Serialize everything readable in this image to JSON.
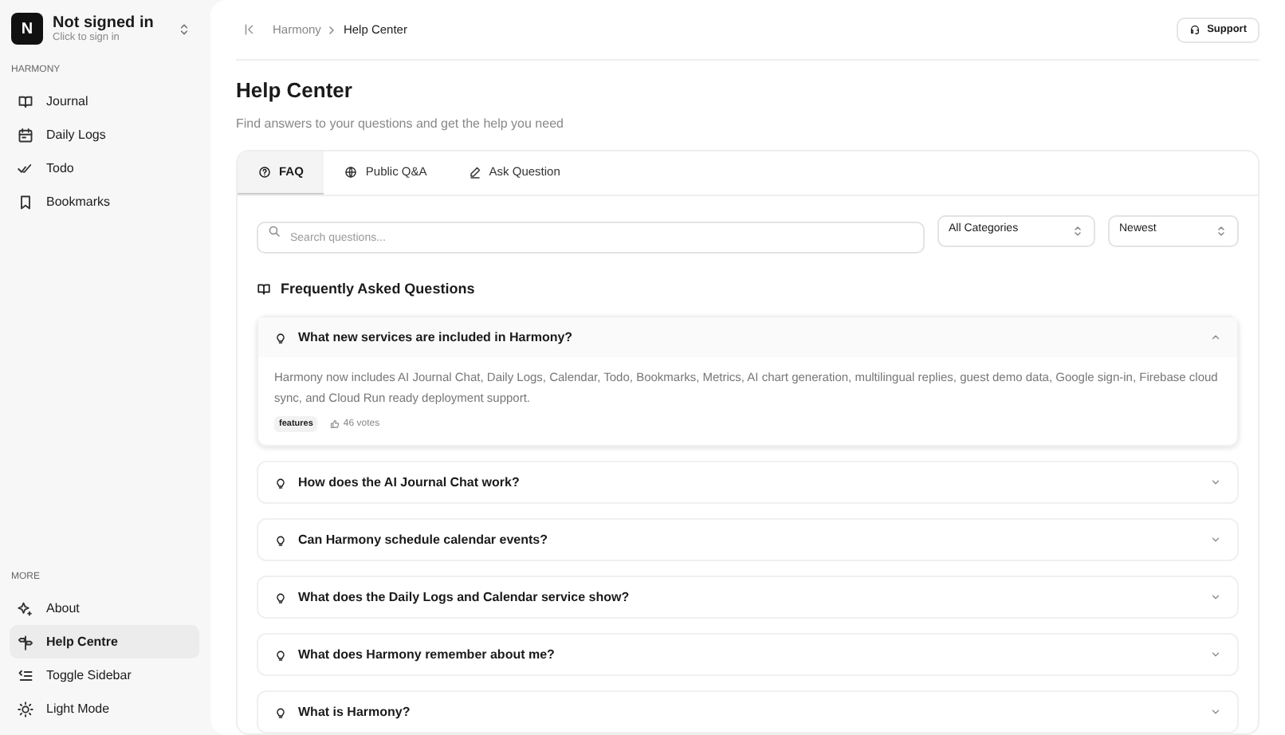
{
  "account": {
    "avatar": "N",
    "name": "Not signed in",
    "hint": "Click to sign in"
  },
  "sidebar": {
    "sections": [
      {
        "heading": "HARMONY",
        "items": [
          {
            "label": "Journal",
            "selected": false
          },
          {
            "label": "Daily Logs",
            "selected": false
          },
          {
            "label": "Todo",
            "selected": false
          },
          {
            "label": "Bookmarks",
            "selected": false
          }
        ]
      },
      {
        "heading": "MORE",
        "items": [
          {
            "label": "About",
            "selected": false
          },
          {
            "label": "Help Centre",
            "selected": true
          },
          {
            "label": "Toggle Sidebar",
            "selected": false
          },
          {
            "label": "Light Mode",
            "selected": false
          }
        ]
      }
    ]
  },
  "breadcrumb": [
    "Harmony",
    "Help Center"
  ],
  "support_button": "Support",
  "page": {
    "title": "Help Center",
    "subtitle": "Find answers to your questions and get the help you need"
  },
  "tabs": [
    {
      "label": "FAQ",
      "selected": true
    },
    {
      "label": "Public Q&A",
      "selected": false
    },
    {
      "label": "Ask Question",
      "selected": false
    }
  ],
  "search": {
    "placeholder": "Search questions..."
  },
  "filters": [
    "All Categories",
    "Newest"
  ],
  "faq": {
    "heading": "Frequently Asked Questions",
    "items": [
      {
        "question": "What new services are included in Harmony?",
        "expanded": true,
        "answer": "Harmony now includes AI Journal Chat, Daily Logs, Calendar, Todo, Bookmarks, Metrics, AI chart generation, multilingual replies, guest demo data, Google sign-in, Firebase cloud sync, and Cloud Run ready deployment support.",
        "tag": "features",
        "votes": "46 votes"
      },
      {
        "question": "How does the AI Journal Chat work?",
        "expanded": false
      },
      {
        "question": "Can Harmony schedule calendar events?",
        "expanded": false
      },
      {
        "question": "What does the Daily Logs and Calendar service show?",
        "expanded": false
      },
      {
        "question": "What does Harmony remember about me?",
        "expanded": false
      },
      {
        "question": "What is Harmony?",
        "expanded": false
      }
    ]
  }
}
